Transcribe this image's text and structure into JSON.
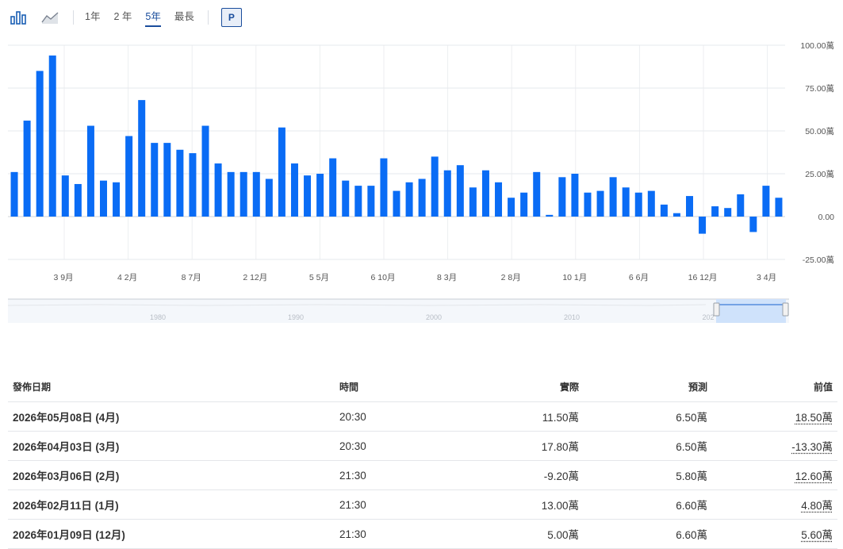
{
  "toolbar": {
    "icons": [
      "bar-chart-icon",
      "area-chart-icon"
    ],
    "ranges": [
      "1年",
      "2 年",
      "5年",
      "最長"
    ],
    "active_range": "5年",
    "p_button": "P"
  },
  "chart_data": {
    "type": "bar",
    "unit": "萬",
    "color": "#0a6cf5",
    "ylim": [
      -25,
      100
    ],
    "yticks": [
      "100.00萬",
      "75.00萬",
      "50.00萬",
      "25.00萬",
      "0.00",
      "-25.00萬"
    ],
    "xticks": [
      "3 9月",
      "4 2月",
      "8 7月",
      "2 12月",
      "5 5月",
      "6 10月",
      "8 3月",
      "2 8月",
      "10 1月",
      "6 6月",
      "16 12月",
      "3 4月"
    ],
    "grid": true,
    "values": [
      26,
      56,
      85,
      94,
      24,
      19,
      53,
      21,
      20,
      47,
      68,
      43,
      43,
      39,
      37,
      53,
      31,
      26,
      26,
      26,
      22,
      52,
      31,
      24,
      25,
      34,
      21,
      18,
      18,
      34,
      15,
      20,
      22,
      35,
      27,
      30,
      17,
      27,
      20,
      11,
      14,
      26,
      1,
      23,
      25,
      14,
      15,
      23,
      17,
      14,
      15,
      7,
      2,
      12,
      -10,
      6,
      5,
      13,
      -9,
      18,
      11
    ]
  },
  "navigator": {
    "years": [
      "1980",
      "1990",
      "2000",
      "2010",
      "202"
    ]
  },
  "table": {
    "headers": [
      "發佈日期",
      "時間",
      "實際",
      "預測",
      "前值"
    ],
    "rows": [
      {
        "date": "2026年05月08日 (4月)",
        "time": "20:30",
        "actual": "11.50萬",
        "actual_color": "green",
        "forecast": "6.50萬",
        "previous": "18.50萬",
        "previous_color": "green"
      },
      {
        "date": "2026年04月03日 (3月)",
        "time": "20:30",
        "actual": "17.80萬",
        "actual_color": "green",
        "forecast": "6.50萬",
        "previous": "-13.30萬",
        "previous_color": "red"
      },
      {
        "date": "2026年03月06日 (2月)",
        "time": "21:30",
        "actual": "-9.20萬",
        "actual_color": "red",
        "forecast": "5.80萬",
        "previous": "12.60萬",
        "previous_color": "red"
      },
      {
        "date": "2026年02月11日 (1月)",
        "time": "21:30",
        "actual": "13.00萬",
        "actual_color": "green",
        "forecast": "6.60萬",
        "previous": "4.80萬",
        "previous_color": "red"
      },
      {
        "date": "2026年01月09日 (12月)",
        "time": "21:30",
        "actual": "5.00萬",
        "actual_color": "red",
        "forecast": "6.60萬",
        "previous": "5.60萬",
        "previous_color": "red"
      }
    ]
  }
}
